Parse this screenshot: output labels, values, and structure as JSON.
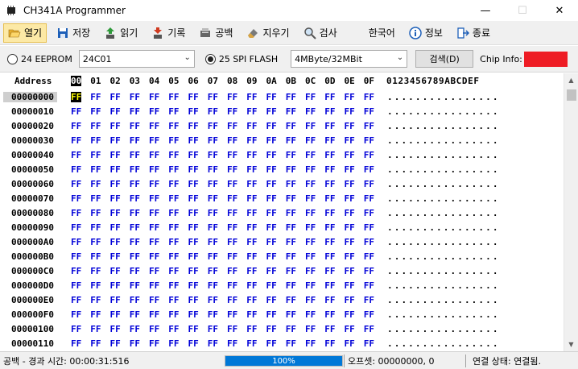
{
  "window": {
    "title": "CH341A Programmer",
    "minimize": "—",
    "maximize": "☐",
    "close": "✕"
  },
  "toolbar": {
    "items": [
      {
        "key": "open",
        "label": "열기",
        "icon": "folder-open-icon",
        "active": true
      },
      {
        "key": "save",
        "label": "저장",
        "icon": "floppy-icon"
      },
      {
        "key": "read",
        "label": "읽기",
        "icon": "chip-read-icon"
      },
      {
        "key": "write",
        "label": "기록",
        "icon": "chip-write-icon"
      },
      {
        "key": "blank",
        "label": "공백",
        "icon": "blank-check-icon"
      },
      {
        "key": "erase",
        "label": "지우기",
        "icon": "eraser-icon"
      },
      {
        "key": "verify",
        "label": "검사",
        "icon": "magnifier-icon"
      },
      {
        "key": "language",
        "label": "한국어",
        "icon": ""
      },
      {
        "key": "about",
        "label": "정보",
        "icon": "info-icon"
      },
      {
        "key": "exit",
        "label": "종료",
        "icon": "exit-icon"
      }
    ]
  },
  "options": {
    "eeprom_label": "24 EEPROM",
    "eeprom_selected": false,
    "eeprom_model": "24C01",
    "flash_label": "25 SPI FLASH",
    "flash_selected": true,
    "flash_model": "4MByte/32MBit",
    "search_button": "검색(D)",
    "chip_info_label": "Chip Info:",
    "chip_info_color": "#ee1c24"
  },
  "hex": {
    "address_header": "Address",
    "columns": [
      "00",
      "01",
      "02",
      "03",
      "04",
      "05",
      "06",
      "07",
      "08",
      "09",
      "0A",
      "0B",
      "0C",
      "0D",
      "0E",
      "0F"
    ],
    "ascii_header": "0123456789ABCDEF",
    "byte_value": "FF",
    "ascii_row": "................",
    "selected_address": "00000000",
    "addresses": [
      "00000000",
      "00000010",
      "00000020",
      "00000030",
      "00000040",
      "00000050",
      "00000060",
      "00000070",
      "00000080",
      "00000090",
      "000000A0",
      "000000B0",
      "000000C0",
      "000000D0",
      "000000E0",
      "000000F0",
      "00000100",
      "00000110"
    ]
  },
  "status": {
    "elapsed": "공백 - 경과 시간: 00:00:31:516",
    "progress_text": "100%",
    "progress_value": 100,
    "offset": "오프셋: 00000000, 0",
    "connection": "연결 상태: 연결됨."
  }
}
